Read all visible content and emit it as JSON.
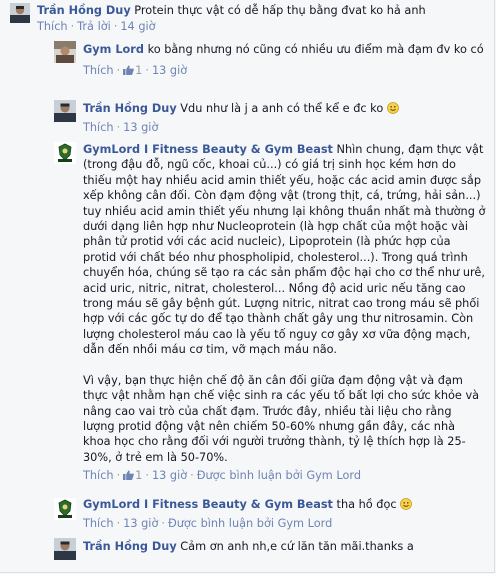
{
  "comments": [
    {
      "author": "Trần Hồng Duy",
      "text": "Protein thực vật có dễ hấp thụ bằng đvat ko hả anh",
      "like_label": "Thích",
      "reply_label": "Trả lời",
      "likes": "",
      "time": "14 giờ"
    },
    {
      "author": "Gym Lord",
      "text": "ko bằng nhưng nó cũng có nhiều ưu điểm mà đạm đv ko có",
      "like_label": "Thích",
      "likes": "1",
      "time": "13 giờ"
    },
    {
      "author": "Trần Hồng Duy",
      "text": "Vdu như là j a anh có thể kể e đc ko",
      "like_label": "Thích",
      "likes": "",
      "time": "13 giờ"
    },
    {
      "author": "GymLord I Fitness Beauty & Gym Beast",
      "text_p1": "Nhìn chung, đạm thực vật (trong đậu đỗ, ngũ cốc, khoai củ...) có giá trị sinh học kém hơn do thiếu một hay nhiều acid amin thiết yếu, hoặc các acid amin được sắp xếp không cân đối. Còn đạm động vật (trong thịt, cá, trứng, hải sản...) tuy nhiều acid amin thiết yếu nhưng lại không thuần nhất mà thường ở dưới dạng liên hợp như Nucleoprotein (là hợp chất của một hoặc vài phân tử protid với các acid nucleic), Lipoprotein (là phức hợp của protid với chất béo như phospholipid, cholesterol...). Trong quá trình chuyển hóa, chúng sẽ tạo ra các sản phẩm độc hại cho cơ thể như urê, acid uric, nitric, nitrat, cholesterol... Nồng độ acid uric nếu tăng cao trong máu sẽ gây bệnh gút. Lượng nitric, nitrat cao trong máu sẽ phối hợp với các gốc tự do để tạo thành chất gây ung thư nitrosamin. Còn lượng cholesterol máu cao là yếu tố nguy cơ gây xơ vữa động mạch, dẫn đến nhồi máu cơ tim, vỡ mạch máu não.",
      "text_p2": "Vì vậy, bạn thực hiện chế độ ăn cân đối giữa đạm động vật và đạm thực vật nhằm hạn chế việc sinh ra các yếu tố bất lợi cho sức khỏe và nâng cao vai trò của chất đạm. Trước đây, nhiều tài liệu cho rằng lượng protid động vật nên chiếm 50-60% nhưng gần đây, các nhà khoa học cho rằng đối với người trưởng thành, tỷ lệ thích hợp là 25-30%, ở trẻ em là 50-70%.",
      "like_label": "Thích",
      "likes": "1",
      "time": "13 giờ",
      "commented_by": "Được bình luận bởi Gym Lord"
    },
    {
      "author": "GymLord I Fitness Beauty & Gym Beast",
      "text": "tha hồ đọc",
      "like_label": "Thích",
      "likes": "",
      "time": "13 giờ",
      "commented_by": "Được bình luận bởi Gym Lord"
    },
    {
      "author": "Trần Hồng Duy",
      "text": "Cảm ơn anh nh,e cứ lăn tăn mãi.thanks a",
      "like_label": "",
      "likes": "",
      "time": ""
    }
  ],
  "colors": {
    "author": "#3b5998",
    "link": "#6d84b4",
    "meta": "#9197a3",
    "text": "#141823",
    "background": "#f6f7f9"
  },
  "icons": {
    "like": "thumbs-up-icon",
    "smile": "smiley-emoji-icon",
    "avatar_duy": "person-avatar-icon",
    "avatar_gymlord": "gym-lord-logo-icon"
  }
}
